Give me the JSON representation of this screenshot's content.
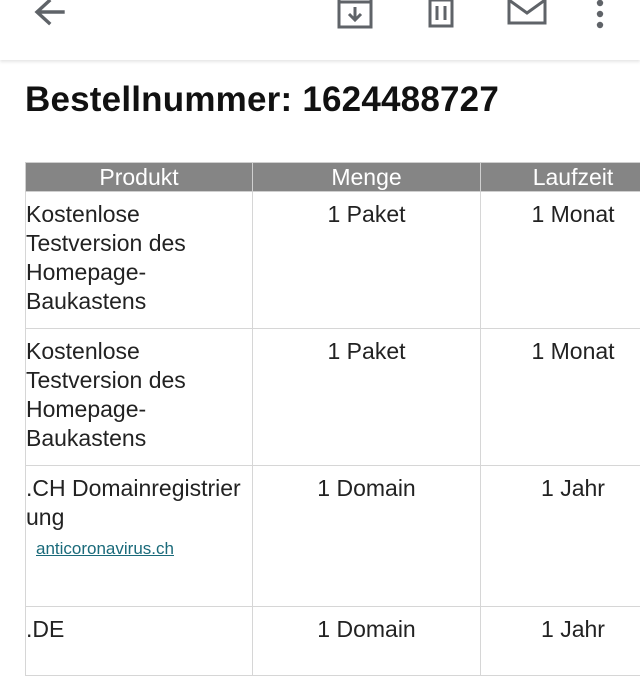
{
  "toolbar": {
    "back_icon": "arrow-left-icon",
    "archive_icon": "archive-download-icon",
    "delete_icon": "trash-icon",
    "mail_icon": "envelope-icon",
    "more_icon": "more-vertical-icon"
  },
  "order": {
    "label": "Bestellnummer:",
    "number": "1624488727"
  },
  "table": {
    "headers": [
      "Produkt",
      "Menge",
      "Laufzeit"
    ],
    "rows": [
      {
        "product": "Kostenlose Testversion des Homepage-Baukastens",
        "quantity": "1 Paket",
        "duration": "1 Monat"
      },
      {
        "product": "Kostenlose Testversion des Homepage-Baukastens",
        "quantity": "1 Paket",
        "duration": "1 Monat"
      },
      {
        "product": ".CH Domainregistrierung",
        "domain": "anticoronavirus.ch",
        "quantity": "1 Domain",
        "duration": "1 Jahr"
      },
      {
        "product": ".DE",
        "quantity": "1 Domain",
        "duration": "1 Jahr"
      }
    ]
  },
  "colors": {
    "header_bg": "#858585",
    "link": "#1a6a7a"
  }
}
